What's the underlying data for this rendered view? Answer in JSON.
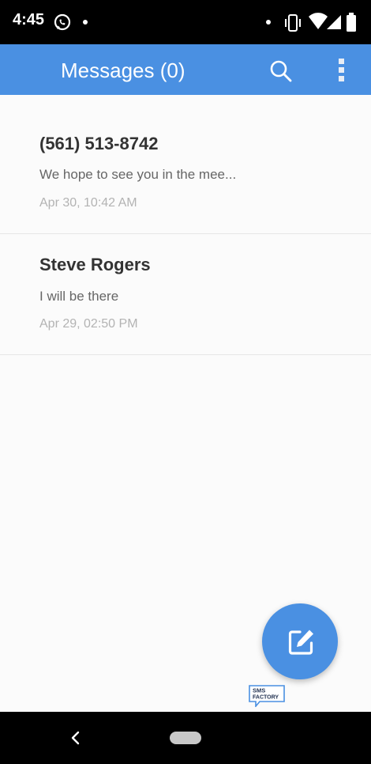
{
  "status_bar": {
    "time": "4:45",
    "left_icons": [
      "whatsapp-icon",
      "notification-dot"
    ],
    "right_icons": [
      "notification-dot",
      "vibrate-icon",
      "wifi-icon",
      "signal-icon",
      "battery-icon"
    ]
  },
  "app_bar": {
    "title": "Messages (0)",
    "color": "#4a90e2",
    "actions": [
      "search-icon",
      "overflow-menu-icon"
    ]
  },
  "messages": [
    {
      "sender": "(561) 513-8742",
      "preview": "We hope to see you in the mee...",
      "date": "Apr 30, 10:42 AM"
    },
    {
      "sender": "Steve Rogers",
      "preview": "I will be there",
      "date": "Apr 29, 02:50 PM"
    }
  ],
  "fab": {
    "icon": "compose-icon",
    "color": "#4a90e2"
  },
  "brand": {
    "line1": "SMS",
    "line2": "FACTORY"
  },
  "nav_bar": {
    "icons": [
      "back-icon",
      "home-pill"
    ]
  }
}
